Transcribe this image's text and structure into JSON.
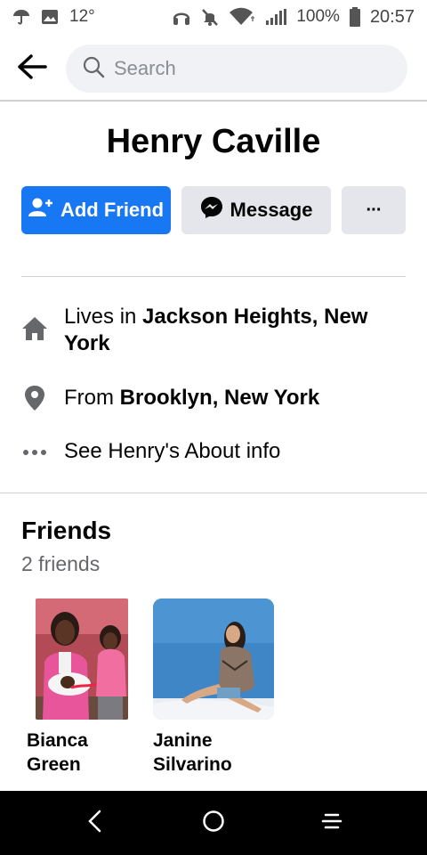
{
  "status_bar": {
    "temperature": "12°",
    "battery_pct": "100%",
    "clock": "20:57"
  },
  "header": {
    "search_placeholder": "Search"
  },
  "profile": {
    "name": "Henry Caville"
  },
  "actions": {
    "add_friend_label": "Add Friend",
    "message_label": "Message",
    "more_label": "···"
  },
  "intro": {
    "lives_prefix": "Lives in ",
    "lives_place": "Jackson Heights, New York",
    "from_prefix": "From ",
    "from_place": "Brooklyn, New York",
    "about_label": "See Henry's About info"
  },
  "friends": {
    "title": "Friends",
    "count": "2 friends",
    "items": [
      {
        "name": "Bianca Green"
      },
      {
        "name": "Janine Silvarino"
      }
    ]
  },
  "colors": {
    "accent": "#1877f2",
    "button_gray": "#e4e6eb",
    "secondary_text": "#65676b",
    "icon_gray": "#65676b"
  }
}
